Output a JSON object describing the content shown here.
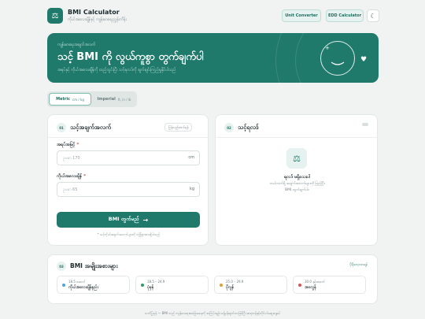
{
  "app": {
    "title": "BMI Calculator",
    "subtitle": "ကိုယ်အလေးချိန်နှင့် ကျန်းမာရေးညွှန်းကိန်း",
    "logo_icon": "scale-icon"
  },
  "toolbar": {
    "unit_converter_label": "Unit Converter",
    "edd_calculator_label": "EDD Calculator",
    "theme_icon": "moon-icon"
  },
  "hero": {
    "eyebrow": "ကျန်းမာရေးအချက်အလက်",
    "title": "သင့် BMI ကို လွယ်ကူစွာ တွက်ချက်ပါ",
    "description": "အရပ်နှင့် ကိုယ်အလေးချိန်ကို ထည့်သွင်းပြီး သင့်ရလဒ်ကို ချက်ချင်းကြည့်ရှုနိုင်ပါသည်",
    "plus_symbol": "+",
    "heart_symbol": "♥"
  },
  "unit_switch": {
    "metric_label": "Metric",
    "metric_units": "cm / kg",
    "imperial_label": "Imperial",
    "imperial_units": "ft, in / lb",
    "selected": "Metric"
  },
  "input_card": {
    "step": "01",
    "title": "သင့်အချက်အလက်",
    "reset_label": "ပြန်လည်စတင်ရန်",
    "height_label": "အရပ်အမြင့်",
    "height_required": "*",
    "height_placeholder": "ဥပမာ 170",
    "height_unit": "cm",
    "weight_label": "ကိုယ်အလေးချိန်",
    "weight_required": "*",
    "weight_placeholder": "ဥပမာ 65",
    "weight_unit": "kg",
    "calculate_label": "BMI တွက်မည်",
    "calculate_arrow": "→",
    "note": "* သင့်ကိုယ်အချက်အလက်များကို လုံခြုံစွာထားရှိပါသည်"
  },
  "result_card": {
    "step": "02",
    "title": "သင့်ရလဒ်",
    "icon": "scale-icon",
    "heading": "ရလဒ် မရှိသေးပါ",
    "line1": "ဘယ်ဘက်ရှိ အချက်အလက်များကို ဖြည့်ပြီး",
    "line2": "BMI တွက်ချက်ပါ။"
  },
  "categories_card": {
    "step": "03",
    "title": "BMI အမျိုးအစားများ",
    "link_label": "ပိုမိုလေ့လာရန်",
    "items": [
      {
        "range": "18.5 အောက်",
        "name": "ကိုယ်အလေးချိန်နည်း",
        "color": "#4aa3df"
      },
      {
        "range": "18.5 – 24.9",
        "name": "ပုံမှန်",
        "color": "#2e9c6a"
      },
      {
        "range": "25.0 – 29.9",
        "name": "ပိုလွန်",
        "color": "#e0a030"
      },
      {
        "range": "30.0 နှင့်အထက်",
        "name": "အဝလွန်",
        "color": "#d9534f"
      }
    ]
  },
  "footer": {
    "text": "သတိပြုရန် — BMI သည် ကျန်းမာရေးအခြေအနေကို အကြမ်းဖျဉ်း ခန့်မှန်းချက်သာဖြစ်ပြီး ဆရာဝန်နှင့်တိုင်ပင်ဆွေးနွေးပါ"
  }
}
